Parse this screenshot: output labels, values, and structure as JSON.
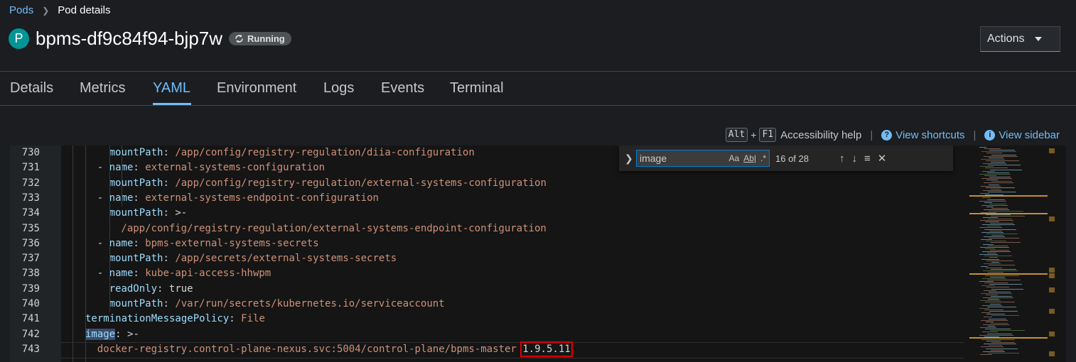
{
  "breadcrumb": {
    "root": "Pods",
    "current": "Pod details"
  },
  "pod": {
    "badge": "P",
    "name": "bpms-df9c84f94-bjp7w",
    "status": "Running"
  },
  "actions": {
    "label": "Actions"
  },
  "tabs": [
    "Details",
    "Metrics",
    "YAML",
    "Environment",
    "Logs",
    "Events",
    "Terminal"
  ],
  "active_tab": "YAML",
  "toolbar": {
    "key1": "Alt",
    "plus": "+",
    "key2": "F1",
    "accessibility_help": "Accessibility help",
    "sep": "|",
    "view_shortcuts": "View shortcuts",
    "view_sidebar": "View sidebar"
  },
  "find": {
    "query": "image",
    "match_case": "Aa",
    "whole_word": "Ab|",
    "regex": ".*",
    "count": "16 of 28"
  },
  "code": {
    "lines": [
      {
        "num": "730",
        "parts": [
          [
            "k",
            "mountPath"
          ],
          [
            "d",
            ": "
          ],
          [
            "v",
            "/app/config/registry-regulation/diia-configuration"
          ]
        ],
        "indent": "    "
      },
      {
        "num": "731",
        "parts": [
          [
            "d",
            "- "
          ],
          [
            "k",
            "name"
          ],
          [
            "d",
            ": "
          ],
          [
            "v",
            "external-systems-configuration"
          ]
        ],
        "indent": "  "
      },
      {
        "num": "732",
        "parts": [
          [
            "k",
            "mountPath"
          ],
          [
            "d",
            ": "
          ],
          [
            "v",
            "/app/config/registry-regulation/external-systems-configuration"
          ]
        ],
        "indent": "    "
      },
      {
        "num": "733",
        "parts": [
          [
            "d",
            "- "
          ],
          [
            "k",
            "name"
          ],
          [
            "d",
            ": "
          ],
          [
            "v",
            "external-systems-endpoint-configuration"
          ]
        ],
        "indent": "  "
      },
      {
        "num": "734",
        "parts": [
          [
            "k",
            "mountPath"
          ],
          [
            "d",
            ": "
          ],
          [
            "d",
            ">-"
          ]
        ],
        "indent": "    "
      },
      {
        "num": "735",
        "parts": [
          [
            "v",
            "/app/config/registry-regulation/external-systems-endpoint-configuration"
          ]
        ],
        "indent": "      "
      },
      {
        "num": "736",
        "parts": [
          [
            "d",
            "- "
          ],
          [
            "k",
            "name"
          ],
          [
            "d",
            ": "
          ],
          [
            "v",
            "bpms-external-systems-secrets"
          ]
        ],
        "indent": "  "
      },
      {
        "num": "737",
        "parts": [
          [
            "k",
            "mountPath"
          ],
          [
            "d",
            ": "
          ],
          [
            "v",
            "/app/secrets/external-systems-secrets"
          ]
        ],
        "indent": "    "
      },
      {
        "num": "738",
        "parts": [
          [
            "d",
            "- "
          ],
          [
            "k",
            "name"
          ],
          [
            "d",
            ": "
          ],
          [
            "v",
            "kube-api-access-hhwpm"
          ]
        ],
        "indent": "  "
      },
      {
        "num": "739",
        "parts": [
          [
            "k",
            "readOnly"
          ],
          [
            "d",
            ": "
          ],
          [
            "d",
            "true"
          ]
        ],
        "indent": "    "
      },
      {
        "num": "740",
        "parts": [
          [
            "k",
            "mountPath"
          ],
          [
            "d",
            ": "
          ],
          [
            "v",
            "/var/run/secrets/kubernetes.io/serviceaccount"
          ]
        ],
        "indent": "    "
      },
      {
        "num": "741",
        "parts": [
          [
            "k",
            "terminationMessagePolicy"
          ],
          [
            "d",
            ": "
          ],
          [
            "v",
            "File"
          ]
        ],
        "indent": ""
      },
      {
        "num": "742",
        "parts": [
          [
            "khl",
            "image"
          ],
          [
            "d",
            ": >-"
          ]
        ],
        "indent": ""
      },
      {
        "num": "743",
        "parts": [
          [
            "v",
            "docker-registry.control-plane-nexus.svc:5004/control-plane/bpms-master "
          ],
          [
            "vsel",
            "1.9.5.11"
          ]
        ],
        "indent": "  "
      }
    ]
  },
  "colors": {
    "accent": "#73bcf7",
    "key": "#9cdcfe",
    "value": "#ce9178",
    "highlight_box": "#e00000"
  }
}
